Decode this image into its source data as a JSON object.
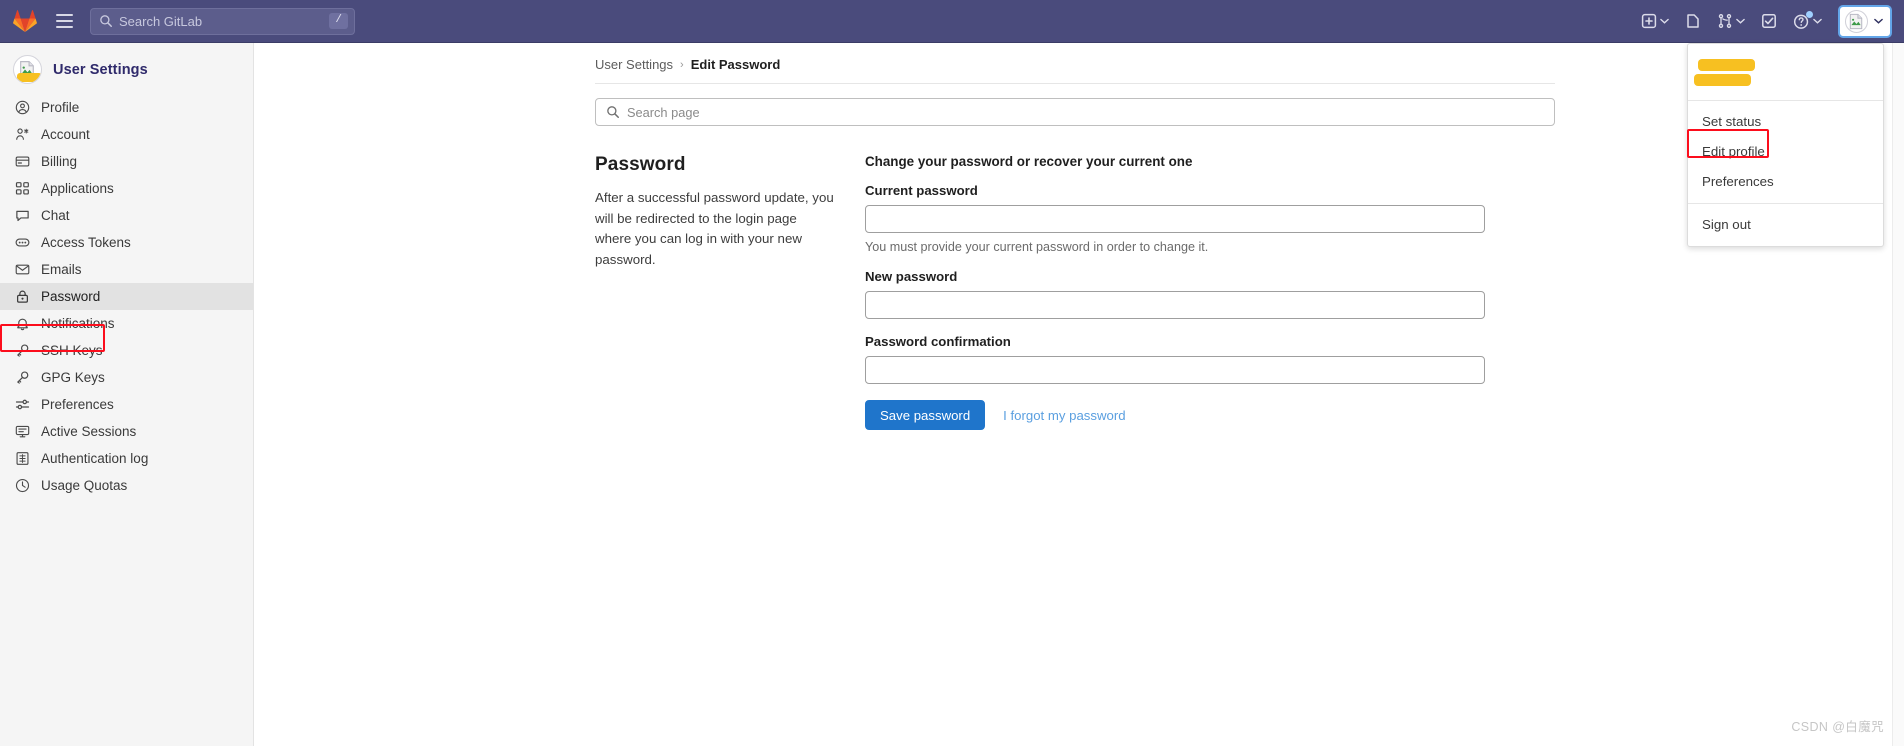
{
  "navbar": {
    "logo_icon": "gitlab-logo-icon",
    "menu_icon": "hamburger-menu-icon",
    "search": {
      "placeholder": "Search GitLab",
      "value": "",
      "icon": "search-icon",
      "shortcut_badge": "/"
    },
    "actions": [
      {
        "name": "create-new-menu",
        "icon": "plus-square-icon",
        "has_chevron": true
      },
      {
        "name": "issues",
        "icon": "issues-icon",
        "has_chevron": false
      },
      {
        "name": "merge-requests-menu",
        "icon": "merge-request-icon",
        "has_chevron": true
      },
      {
        "name": "todos",
        "icon": "todo-checkbox-icon",
        "has_chevron": false
      },
      {
        "name": "help-menu",
        "icon": "question-circle-icon",
        "has_chevron": true,
        "badge_dot": true
      }
    ],
    "avatar": {
      "icon": "broken-image-avatar-icon",
      "has_chevron": true,
      "focused": true
    },
    "bg_color": "#4a4b7c"
  },
  "sidebar": {
    "title": "User Settings",
    "avatar_icon": "broken-image-avatar-icon",
    "items": [
      {
        "label": "Profile",
        "icon": "user-circle-icon",
        "active": false
      },
      {
        "label": "Account",
        "icon": "account-key-icon",
        "active": false
      },
      {
        "label": "Billing",
        "icon": "credit-card-icon",
        "active": false
      },
      {
        "label": "Applications",
        "icon": "applications-grid-icon",
        "active": false
      },
      {
        "label": "Chat",
        "icon": "chat-bubble-icon",
        "active": false
      },
      {
        "label": "Access Tokens",
        "icon": "token-dots-icon",
        "active": false
      },
      {
        "label": "Emails",
        "icon": "envelope-icon",
        "active": false
      },
      {
        "label": "Password",
        "icon": "lock-icon",
        "active": true
      },
      {
        "label": "Notifications",
        "icon": "bell-icon",
        "active": false
      },
      {
        "label": "SSH Keys",
        "icon": "key-icon",
        "active": false
      },
      {
        "label": "GPG Keys",
        "icon": "key-icon",
        "active": false
      },
      {
        "label": "Preferences",
        "icon": "sliders-icon",
        "active": false
      },
      {
        "label": "Active Sessions",
        "icon": "monitor-icon",
        "active": false
      },
      {
        "label": "Authentication log",
        "icon": "log-list-icon",
        "active": false
      },
      {
        "label": "Usage Quotas",
        "icon": "clock-quota-icon",
        "active": false
      }
    ]
  },
  "breadcrumb": {
    "root": "User Settings",
    "separator": "›",
    "current": "Edit Password"
  },
  "page_search": {
    "placeholder": "Search page",
    "value": "",
    "icon": "search-icon"
  },
  "section": {
    "heading": "Password",
    "description": "After a successful password update, you will be redirected to the login page where you can log in with your new password."
  },
  "form": {
    "legend": "Change your password or recover your current one",
    "fields": [
      {
        "label": "Current password",
        "value": "",
        "placeholder": "",
        "hint": "You must provide your current password in order to change it."
      },
      {
        "label": "New password",
        "value": "",
        "placeholder": "",
        "hint": ""
      },
      {
        "label": "Password confirmation",
        "value": "",
        "placeholder": "",
        "hint": ""
      }
    ],
    "submit_label": "Save password",
    "forgot_link": "I forgot my password",
    "primary_color": "#1f75cb"
  },
  "avatar_dropdown": {
    "user_name_redacted": true,
    "items": [
      {
        "label": "Set status",
        "highlighted": false
      },
      {
        "label": "Edit profile",
        "highlighted": true
      },
      {
        "label": "Preferences",
        "highlighted": false
      }
    ],
    "sign_out": "Sign out"
  },
  "annotations": {
    "color": "#fc0d1c",
    "targets": [
      "sidebar-item-password",
      "dropdown-item-edit-profile"
    ]
  },
  "watermark": "CSDN @白魔咒"
}
